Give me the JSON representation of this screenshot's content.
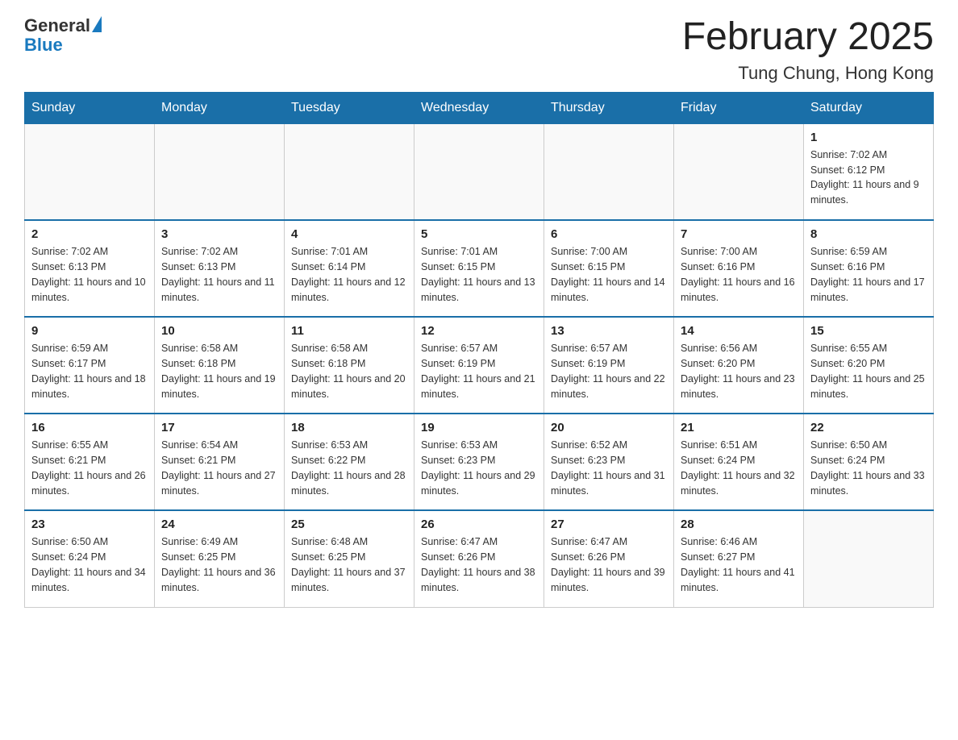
{
  "header": {
    "logo_general": "General",
    "logo_blue": "Blue",
    "month_title": "February 2025",
    "location": "Tung Chung, Hong Kong"
  },
  "weekdays": [
    "Sunday",
    "Monday",
    "Tuesday",
    "Wednesday",
    "Thursday",
    "Friday",
    "Saturday"
  ],
  "weeks": [
    [
      {
        "day": "",
        "sunrise": "",
        "sunset": "",
        "daylight": ""
      },
      {
        "day": "",
        "sunrise": "",
        "sunset": "",
        "daylight": ""
      },
      {
        "day": "",
        "sunrise": "",
        "sunset": "",
        "daylight": ""
      },
      {
        "day": "",
        "sunrise": "",
        "sunset": "",
        "daylight": ""
      },
      {
        "day": "",
        "sunrise": "",
        "sunset": "",
        "daylight": ""
      },
      {
        "day": "",
        "sunrise": "",
        "sunset": "",
        "daylight": ""
      },
      {
        "day": "1",
        "sunrise": "Sunrise: 7:02 AM",
        "sunset": "Sunset: 6:12 PM",
        "daylight": "Daylight: 11 hours and 9 minutes."
      }
    ],
    [
      {
        "day": "2",
        "sunrise": "Sunrise: 7:02 AM",
        "sunset": "Sunset: 6:13 PM",
        "daylight": "Daylight: 11 hours and 10 minutes."
      },
      {
        "day": "3",
        "sunrise": "Sunrise: 7:02 AM",
        "sunset": "Sunset: 6:13 PM",
        "daylight": "Daylight: 11 hours and 11 minutes."
      },
      {
        "day": "4",
        "sunrise": "Sunrise: 7:01 AM",
        "sunset": "Sunset: 6:14 PM",
        "daylight": "Daylight: 11 hours and 12 minutes."
      },
      {
        "day": "5",
        "sunrise": "Sunrise: 7:01 AM",
        "sunset": "Sunset: 6:15 PM",
        "daylight": "Daylight: 11 hours and 13 minutes."
      },
      {
        "day": "6",
        "sunrise": "Sunrise: 7:00 AM",
        "sunset": "Sunset: 6:15 PM",
        "daylight": "Daylight: 11 hours and 14 minutes."
      },
      {
        "day": "7",
        "sunrise": "Sunrise: 7:00 AM",
        "sunset": "Sunset: 6:16 PM",
        "daylight": "Daylight: 11 hours and 16 minutes."
      },
      {
        "day": "8",
        "sunrise": "Sunrise: 6:59 AM",
        "sunset": "Sunset: 6:16 PM",
        "daylight": "Daylight: 11 hours and 17 minutes."
      }
    ],
    [
      {
        "day": "9",
        "sunrise": "Sunrise: 6:59 AM",
        "sunset": "Sunset: 6:17 PM",
        "daylight": "Daylight: 11 hours and 18 minutes."
      },
      {
        "day": "10",
        "sunrise": "Sunrise: 6:58 AM",
        "sunset": "Sunset: 6:18 PM",
        "daylight": "Daylight: 11 hours and 19 minutes."
      },
      {
        "day": "11",
        "sunrise": "Sunrise: 6:58 AM",
        "sunset": "Sunset: 6:18 PM",
        "daylight": "Daylight: 11 hours and 20 minutes."
      },
      {
        "day": "12",
        "sunrise": "Sunrise: 6:57 AM",
        "sunset": "Sunset: 6:19 PM",
        "daylight": "Daylight: 11 hours and 21 minutes."
      },
      {
        "day": "13",
        "sunrise": "Sunrise: 6:57 AM",
        "sunset": "Sunset: 6:19 PM",
        "daylight": "Daylight: 11 hours and 22 minutes."
      },
      {
        "day": "14",
        "sunrise": "Sunrise: 6:56 AM",
        "sunset": "Sunset: 6:20 PM",
        "daylight": "Daylight: 11 hours and 23 minutes."
      },
      {
        "day": "15",
        "sunrise": "Sunrise: 6:55 AM",
        "sunset": "Sunset: 6:20 PM",
        "daylight": "Daylight: 11 hours and 25 minutes."
      }
    ],
    [
      {
        "day": "16",
        "sunrise": "Sunrise: 6:55 AM",
        "sunset": "Sunset: 6:21 PM",
        "daylight": "Daylight: 11 hours and 26 minutes."
      },
      {
        "day": "17",
        "sunrise": "Sunrise: 6:54 AM",
        "sunset": "Sunset: 6:21 PM",
        "daylight": "Daylight: 11 hours and 27 minutes."
      },
      {
        "day": "18",
        "sunrise": "Sunrise: 6:53 AM",
        "sunset": "Sunset: 6:22 PM",
        "daylight": "Daylight: 11 hours and 28 minutes."
      },
      {
        "day": "19",
        "sunrise": "Sunrise: 6:53 AM",
        "sunset": "Sunset: 6:23 PM",
        "daylight": "Daylight: 11 hours and 29 minutes."
      },
      {
        "day": "20",
        "sunrise": "Sunrise: 6:52 AM",
        "sunset": "Sunset: 6:23 PM",
        "daylight": "Daylight: 11 hours and 31 minutes."
      },
      {
        "day": "21",
        "sunrise": "Sunrise: 6:51 AM",
        "sunset": "Sunset: 6:24 PM",
        "daylight": "Daylight: 11 hours and 32 minutes."
      },
      {
        "day": "22",
        "sunrise": "Sunrise: 6:50 AM",
        "sunset": "Sunset: 6:24 PM",
        "daylight": "Daylight: 11 hours and 33 minutes."
      }
    ],
    [
      {
        "day": "23",
        "sunrise": "Sunrise: 6:50 AM",
        "sunset": "Sunset: 6:24 PM",
        "daylight": "Daylight: 11 hours and 34 minutes."
      },
      {
        "day": "24",
        "sunrise": "Sunrise: 6:49 AM",
        "sunset": "Sunset: 6:25 PM",
        "daylight": "Daylight: 11 hours and 36 minutes."
      },
      {
        "day": "25",
        "sunrise": "Sunrise: 6:48 AM",
        "sunset": "Sunset: 6:25 PM",
        "daylight": "Daylight: 11 hours and 37 minutes."
      },
      {
        "day": "26",
        "sunrise": "Sunrise: 6:47 AM",
        "sunset": "Sunset: 6:26 PM",
        "daylight": "Daylight: 11 hours and 38 minutes."
      },
      {
        "day": "27",
        "sunrise": "Sunrise: 6:47 AM",
        "sunset": "Sunset: 6:26 PM",
        "daylight": "Daylight: 11 hours and 39 minutes."
      },
      {
        "day": "28",
        "sunrise": "Sunrise: 6:46 AM",
        "sunset": "Sunset: 6:27 PM",
        "daylight": "Daylight: 11 hours and 41 minutes."
      },
      {
        "day": "",
        "sunrise": "",
        "sunset": "",
        "daylight": ""
      }
    ]
  ]
}
